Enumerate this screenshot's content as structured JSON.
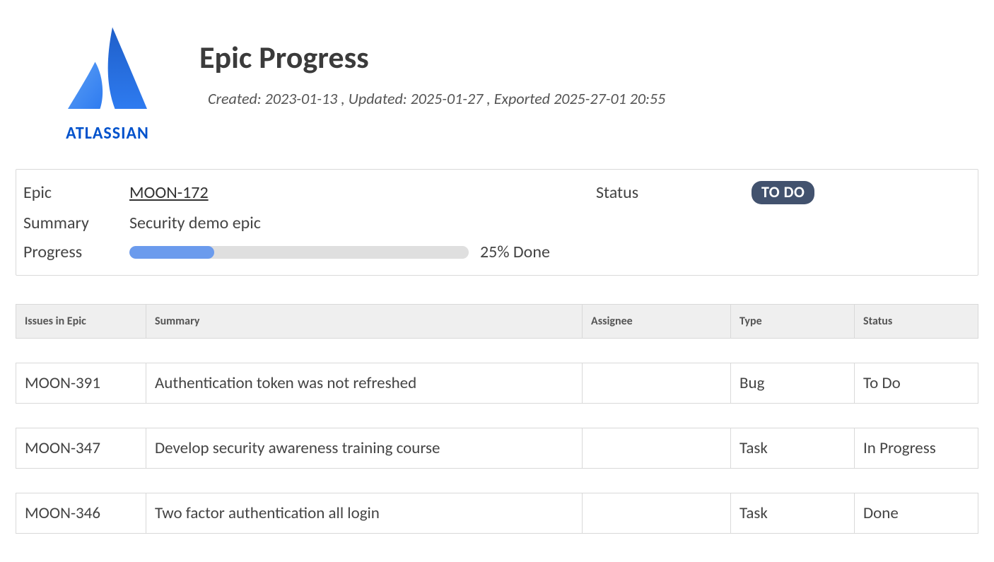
{
  "brand": {
    "name": "ATLASSIAN"
  },
  "header": {
    "title": "Epic Progress",
    "meta": "Created: 2023-01-13 , Updated: 2025-01-27 , Exported 2025-27-01 20:55"
  },
  "epic": {
    "labels": {
      "epic": "Epic",
      "summary": "Summary",
      "progress": "Progress",
      "status": "Status"
    },
    "key": "MOON-172",
    "summary": "Security demo epic",
    "status_badge": "TO DO",
    "progress_percent": 25,
    "progress_text": "25% Done"
  },
  "table": {
    "headers": {
      "key": "Issues in Epic",
      "summary": "Summary",
      "assignee": "Assignee",
      "type": "Type",
      "status": "Status"
    },
    "rows": [
      {
        "key": "MOON-391",
        "summary": "Authentication token was not refreshed",
        "assignee": "",
        "type": "Bug",
        "status": "To Do",
        "status_class": "st-todo"
      },
      {
        "key": "MOON-347",
        "summary": "Develop security awareness training course",
        "assignee": "",
        "type": "Task",
        "status": "In Progress",
        "status_class": "st-progress"
      },
      {
        "key": "MOON-346",
        "summary": "Two factor authentication all login",
        "assignee": "",
        "type": "Task",
        "status": "Done",
        "status_class": "st-done"
      }
    ]
  }
}
